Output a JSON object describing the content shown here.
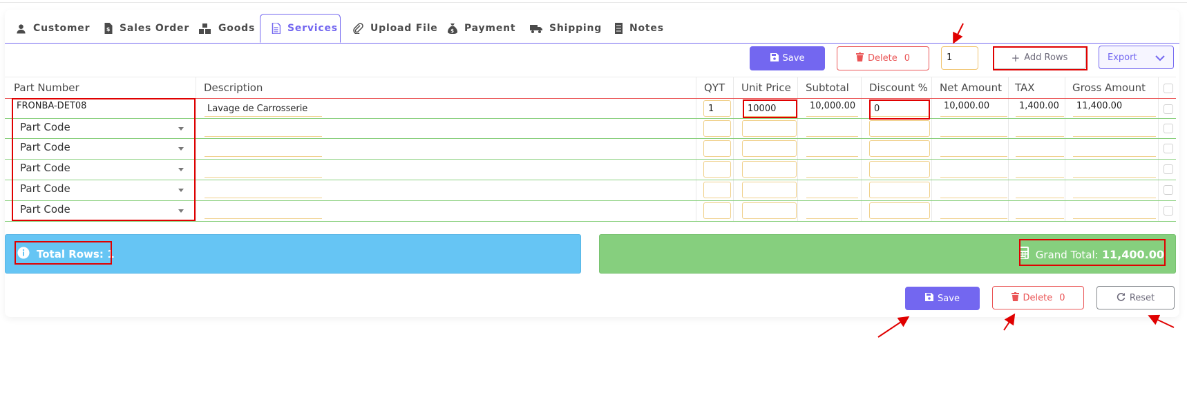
{
  "tabs": [
    {
      "label": "Customer",
      "icon": "user-icon"
    },
    {
      "label": "Sales Order",
      "icon": "invoice-icon"
    },
    {
      "label": "Goods",
      "icon": "boxes-icon"
    },
    {
      "label": "Services",
      "icon": "document-icon"
    },
    {
      "label": "Upload File",
      "icon": "paperclip-icon"
    },
    {
      "label": "Payment",
      "icon": "money-bag-icon"
    },
    {
      "label": "Shipping",
      "icon": "truck-icon"
    },
    {
      "label": "Notes",
      "icon": "notebook-icon"
    }
  ],
  "active_tab": "Services",
  "toolbar": {
    "save_label": "Save",
    "delete_label": "Delete",
    "delete_count": "0",
    "row_count_value": "1",
    "add_rows_label": "Add Rows",
    "export_label": "Export"
  },
  "table": {
    "headers": [
      "Part Number",
      "Description",
      "QYT",
      "Unit Price",
      "Subtotal",
      "Discount %",
      "Net Amount",
      "TAX",
      "Gross Amount"
    ],
    "first_row": {
      "part_number": "FRONBA-DET08",
      "description": "Lavage de Carrosserie",
      "qty": "1",
      "unit_price": "10000",
      "subtotal": "10,000.00",
      "discount": "0",
      "net_amount": "10,000.00",
      "tax": "1,400.00",
      "gross_amount": "11,400.00"
    },
    "empty_rows_placeholder": [
      "Part Code",
      "Part Code",
      "Part Code",
      "Part Code",
      "Part Code"
    ]
  },
  "footer": {
    "total_rows_label": "Total Rows:",
    "total_rows_value": "1",
    "grand_total_label": "Grand Total:",
    "grand_total_value": "11,400.00",
    "save_label": "Save",
    "delete_label": "Delete",
    "delete_count": "0",
    "reset_label": "Reset"
  },
  "colors": {
    "primary": "#7367f0",
    "danger": "#ea5455",
    "info_bar": "#66c5f4",
    "total_bar": "#86cf7e",
    "annotation": "#e00000"
  }
}
